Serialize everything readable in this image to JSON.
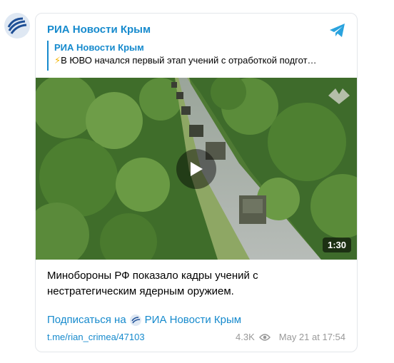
{
  "post": {
    "channel_name": "РИА Новости Крым",
    "reply": {
      "title": "РИА Новости Крым",
      "text": "В ЮВО начался первый этап учений с отработкой подгот…",
      "icon": "lightning-emoji"
    },
    "video": {
      "duration": "1:30"
    },
    "message": "Минобороны РФ показало кадры учений с нестратегическим ядерным оружием.",
    "subscribe_prefix": "Подписаться на",
    "subscribe_channel": "РИА Новости Крым",
    "link": "t.me/rian_crimea/47103",
    "views": "4.3K",
    "date": "May 21 at 17:54"
  },
  "colors": {
    "accent": "#168acd",
    "muted": "#999999",
    "bolt": "#f4b400"
  }
}
